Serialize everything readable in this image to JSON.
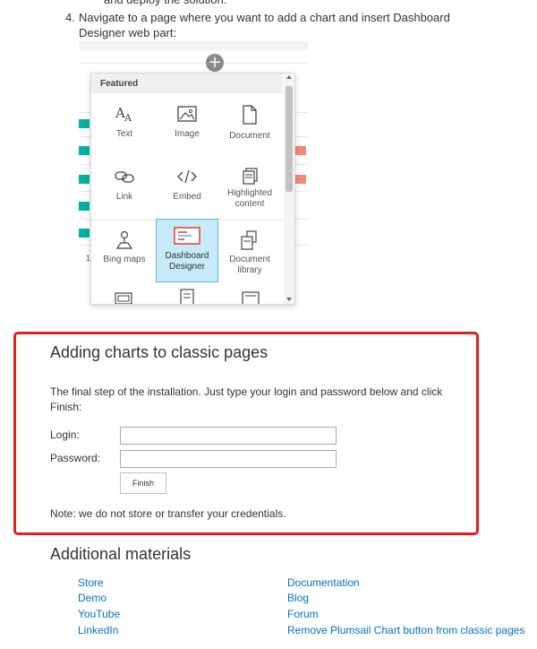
{
  "intro": {
    "cut_line": "and deploy the solution.",
    "step_number": "4.",
    "step_line1": "Navigate to a page where you want to add a chart and insert Dashboard",
    "step_line2": "Designer web part:"
  },
  "toolbox": {
    "header": "Featured",
    "items": [
      {
        "label": "Text",
        "icon": "text-icon"
      },
      {
        "label": "Image",
        "icon": "image-icon"
      },
      {
        "label": "Document",
        "icon": "document-icon"
      },
      {
        "label": "Link",
        "icon": "link-icon"
      },
      {
        "label": "Embed",
        "icon": "embed-icon"
      },
      {
        "label_line1": "Highlighted",
        "label_line2": "content",
        "icon": "highlighted-content-icon"
      },
      {
        "label": "Bing maps",
        "icon": "bing-maps-icon"
      },
      {
        "label_line1": "Dashboard",
        "label_line2": "Designer",
        "icon": "dashboard-designer-icon",
        "selected": true
      },
      {
        "label_line1": "Document",
        "label_line2": "library",
        "icon": "document-library-icon"
      }
    ],
    "add_button": "+"
  },
  "classic": {
    "title": "Adding charts to classic pages",
    "description_line1": "The final step of the installation. Just type your login and password below and click",
    "description_line2": "Finish:",
    "login_label": "Login:",
    "login_value": "",
    "password_label": "Password:",
    "password_value": "",
    "finish_label": "Finish",
    "note": "Note: we do not store or transfer your credentials."
  },
  "materials": {
    "title": "Additional materials",
    "left_links": [
      "Store",
      "Demo",
      "YouTube",
      "LinkedIn"
    ],
    "right_links": [
      "Documentation",
      "Blog",
      "Forum",
      "Remove Plumsail Chart button from classic pages"
    ]
  },
  "colors": {
    "accent_red": "#e02020",
    "link_blue": "#0072c6",
    "teal_bar": "#00b2a0",
    "salmon_bar": "#f2897a",
    "dashboard_icon_red": "#e04a3c",
    "selected_tile_bg": "#c7ebf6"
  }
}
